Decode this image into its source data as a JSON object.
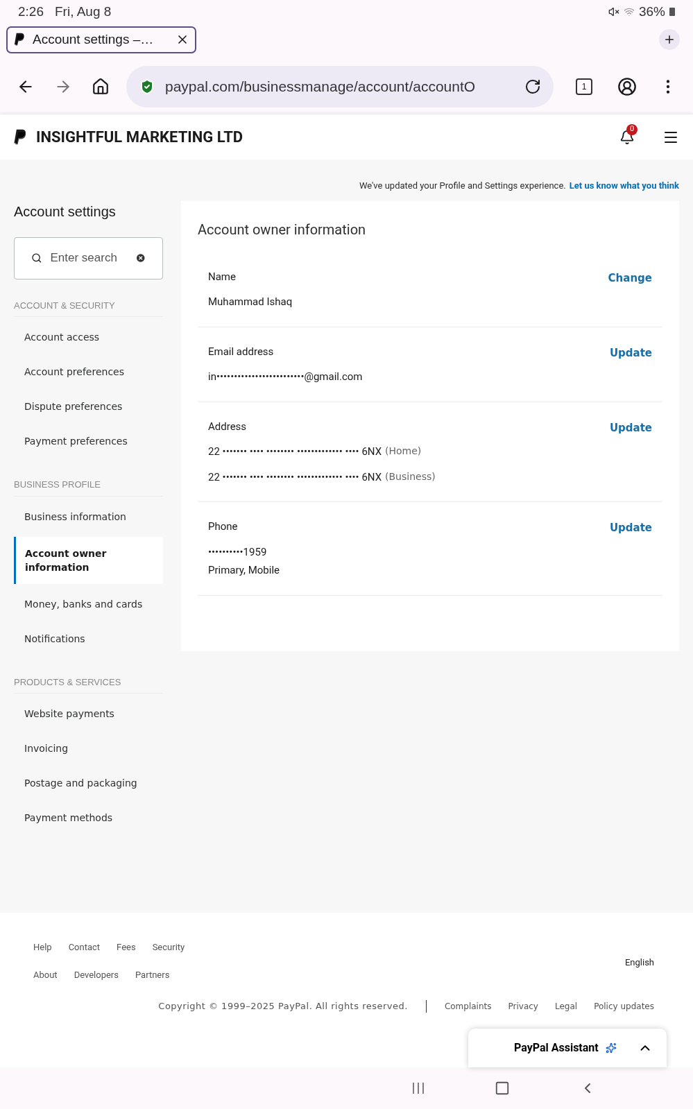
{
  "status_bar": {
    "time": "2:26",
    "date": "Fri, Aug 8",
    "battery": "36%"
  },
  "browser": {
    "tab_title": "Account settings –…",
    "url": "paypal.com/businessmanage/account/accountO",
    "tab_count": "1"
  },
  "header": {
    "company": "INSIGHTFUL MARKETING LTD",
    "notification_count": "0"
  },
  "banner": {
    "text": "We've updated your Profile and Settings experience.",
    "link": "Let us know what you think"
  },
  "sidebar": {
    "title": "Account settings",
    "search": {
      "placeholder": "Enter search"
    },
    "sections": [
      {
        "heading": "ACCOUNT & SECURITY",
        "items": [
          {
            "label": "Account access",
            "selected": false
          },
          {
            "label": "Account preferences",
            "selected": false
          },
          {
            "label": "Dispute preferences",
            "selected": false
          },
          {
            "label": "Payment preferences",
            "selected": false
          }
        ]
      },
      {
        "heading": "BUSINESS PROFILE",
        "items": [
          {
            "label": "Business information",
            "selected": false
          },
          {
            "label": "Account owner information",
            "selected": true
          },
          {
            "label": "Money, banks and cards",
            "selected": false
          },
          {
            "label": "Notifications",
            "selected": false
          }
        ]
      },
      {
        "heading": "PRODUCTS & SERVICES",
        "items": [
          {
            "label": "Website payments",
            "selected": false
          },
          {
            "label": "Invoicing",
            "selected": false
          },
          {
            "label": "Postage and packaging",
            "selected": false
          },
          {
            "label": "Payment methods",
            "selected": false
          }
        ]
      }
    ]
  },
  "card": {
    "title": "Account owner information",
    "fields": [
      {
        "label": "Name",
        "action": "Change",
        "lines": [
          {
            "text": "Muhammad Ishaq"
          }
        ]
      },
      {
        "label": "Email address",
        "action": "Update",
        "lines": [
          {
            "text": "in•••••••••••••••••••••••••@gmail.com"
          }
        ]
      },
      {
        "label": "Address",
        "action": "Update",
        "lines": [
          {
            "text": "22 ••••••• •••• •••••••• ••••••••••••• •••• 6NX",
            "note": "(Home)"
          },
          {
            "text": "22 ••••••• •••• •••••••• ••••••••••••• •••• 6NX",
            "note": "(Business)"
          }
        ]
      },
      {
        "label": "Phone",
        "action": "Update",
        "lines": [
          {
            "text": "••••••••••1959"
          },
          {
            "text": "Primary, Mobile"
          }
        ]
      }
    ]
  },
  "footer": {
    "link_rows": [
      [
        "Help",
        "Contact",
        "Fees",
        "Security"
      ],
      [
        "About",
        "Developers",
        "Partners"
      ]
    ],
    "language": "English",
    "copyright": "Copyright © 1999–2025 PayPal. All rights reserved.",
    "legal_links": [
      "Complaints",
      "Privacy",
      "Legal",
      "Policy updates"
    ]
  },
  "assistant": {
    "label": "PayPal Assistant"
  }
}
